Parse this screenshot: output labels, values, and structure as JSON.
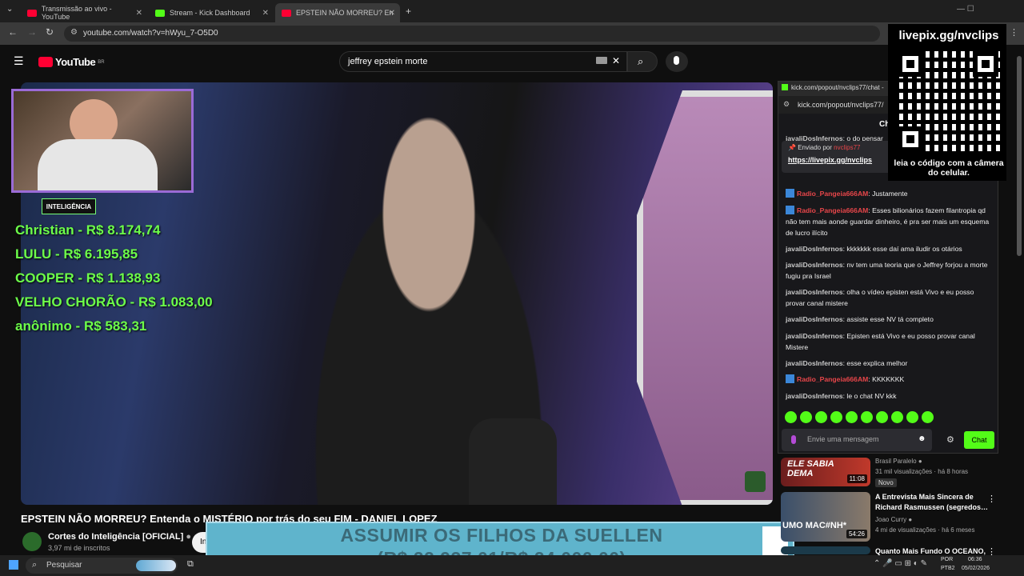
{
  "tabs": [
    {
      "label": "Transmissão ao vivo - YouTube",
      "color": "#ff0033"
    },
    {
      "label": "Stream - Kick Dashboard",
      "color": "#53fc18"
    },
    {
      "label": "EPSTEIN NÃO MORREU? En",
      "color": "#ff0033"
    }
  ],
  "address": {
    "url": "youtube.com/watch?v=hWyu_7-O5D0"
  },
  "youtube": {
    "logo": "YouTube",
    "region": "BR",
    "search_value": "jeffrey epstein morte"
  },
  "overlay": {
    "webcam_badge": "INTELIGÊNCIA",
    "donors": [
      "Christian - R$ 8.174,74",
      "LULU - R$ 6.195,85",
      "COOPER - R$ 1.138,93",
      "VELHO CHORÃO - R$ 1.083,00",
      "anônimo - R$ 583,31"
    ],
    "goal_line1": "ASSUMIR OS FILHOS DA SUELLEN",
    "goal_line2": "(R$ 22.937,01/R$ 24.000,00)",
    "goal_progress": 0.9557,
    "qr_header": "livepix.gg/nvclips",
    "qr_caption": "leia o código com a câmera do celular."
  },
  "video": {
    "title": "EPSTEIN NÃO MORREU? Entenda o MISTÉRIO por trás do seu FIM - DANIEL LOPEZ",
    "channel": "Cortes do Inteligência [OFICIAL]",
    "subscribers": "3,97 mi de inscritos",
    "subscribe_label": "In"
  },
  "popout": {
    "tab_title": "kick.com/popout/nvclips77/chat -",
    "url": "kick.com/popout/nvclips77/",
    "header": "Chat",
    "pinned_by": "Enviado por",
    "pinned_user": "nvclips77",
    "pinned_link": "https://livepix.gg/nvclips",
    "messages": [
      {
        "user": "javaliDosInfernos",
        "text": "o do pensar",
        "red": false,
        "badge": false
      },
      {
        "user": "Radio_Pangeia666AM",
        "text": "Justamente",
        "red": true,
        "badge": true
      },
      {
        "user": "Radio_Pangeia666AM",
        "text": "Esses bilionários fazem filantropia qd não tem mais aonde guardar dinheiro, é pra ser mais um esquema de lucro ilícito",
        "red": true,
        "badge": true
      },
      {
        "user": "javaliDosInfernos",
        "text": "kkkkkkk esse daí ama iludir os otários",
        "red": false,
        "badge": false
      },
      {
        "user": "javaliDosInfernos",
        "text": "nv tem uma teoria que o Jeffrey forjou a morte fugiu pra Israel",
        "red": false,
        "badge": false
      },
      {
        "user": "javaliDosInfernos",
        "text": "olha o vídeo episten está Vivo e eu posso provar canal mistere",
        "red": false,
        "badge": false
      },
      {
        "user": "javaliDosInfernos",
        "text": "assiste esse NV tá completo",
        "red": false,
        "badge": false
      },
      {
        "user": "javaliDosInfernos",
        "text": "Episten está Vivo e eu posso provar canal Mistere",
        "red": false,
        "badge": false
      },
      {
        "user": "javaliDosInfernos",
        "text": "esse explica melhor",
        "red": false,
        "badge": false
      },
      {
        "user": "Radio_Pangeia666AM",
        "text": "KKKKKKK",
        "red": true,
        "badge": true
      },
      {
        "user": "javaliDosInfernos",
        "text": "le o chat NV kkk",
        "red": false,
        "badge": false
      }
    ],
    "input_placeholder": "Envie uma mensagem",
    "chat_button": "Chat"
  },
  "recommendations": [
    {
      "title": "",
      "thumb_text": "ELE SABIA DEMA",
      "channel": "Brasil Paralelo",
      "meta": "31 mil visualizações · há 8 horas",
      "badge": "Novo",
      "duration": "11:08"
    },
    {
      "title": "A Entrevista Mais Sincera de Richard Rasmussen (segredos…",
      "thumb_text": "UMO MAC#NH*",
      "channel": "Joao Curry",
      "meta": "4 mi de visualizações · há 6 meses",
      "badge": "",
      "duration": "54:26"
    },
    {
      "title": "Quanto Mais Fundo O OCEANO,",
      "thumb_text": "",
      "channel": "",
      "meta": "",
      "badge": "",
      "duration": ""
    }
  ],
  "taskbar": {
    "search": "Pesquisar",
    "lang1": "POR",
    "lang2": "PTB2",
    "time": "06:36",
    "date": "05/02/2026"
  }
}
